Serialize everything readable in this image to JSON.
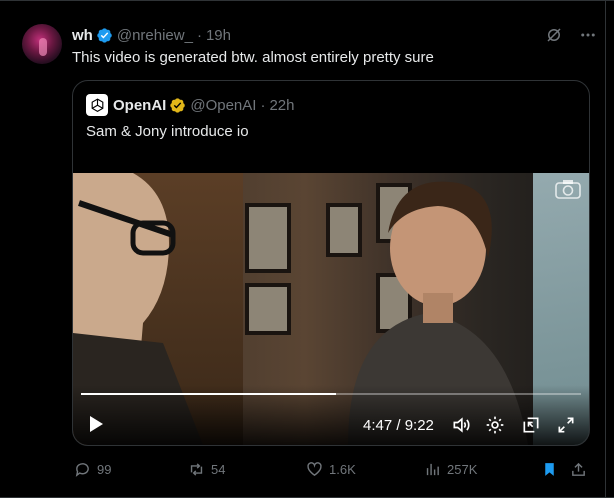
{
  "tweet": {
    "author_name": "wh",
    "handle": "@nrehiew_",
    "separator": "·",
    "time": "19h",
    "text": "This video is generated btw. almost entirely pretty sure"
  },
  "quote": {
    "author_name": "OpenAI",
    "handle": "@OpenAI",
    "separator": "·",
    "time": "22h",
    "text": "Sam & Jony introduce io"
  },
  "video": {
    "time_label": "4:47 / 9:22",
    "progress_fraction": 0.51
  },
  "actions": {
    "replies": "99",
    "reposts": "54",
    "likes": "1.6K",
    "views": "257K"
  },
  "colors": {
    "background": "#000000",
    "verified_blue": "#1d9bf0",
    "verified_gold": "#e2b719",
    "muted": "#71767b",
    "bookmark_active": "#1d9bf0"
  },
  "icons": [
    "verified-badge-icon",
    "grok-icon",
    "more-icon",
    "openai-logo-icon",
    "gold-verified-icon",
    "play-icon",
    "volume-icon",
    "settings-icon",
    "pip-icon",
    "fullscreen-icon",
    "reply-icon",
    "repost-icon",
    "like-icon",
    "views-icon",
    "bookmark-icon",
    "share-icon"
  ]
}
